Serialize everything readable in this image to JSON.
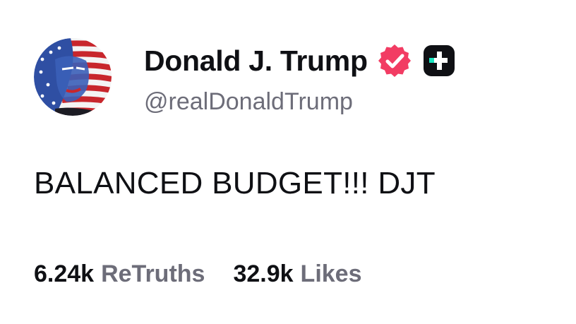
{
  "author": {
    "display_name": "Donald J. Trump",
    "handle": "@realDonaldTrump",
    "verified_icon": "verified-badge-icon",
    "verified_color": "#f23c63",
    "extra_badge_icon": "plus-badge-icon",
    "extra_badge_color": "#0f1014",
    "extra_badge_accent": "#19e5c0"
  },
  "post": {
    "text": "BALANCED BUDGET!!! DJT"
  },
  "stats": {
    "retruths_count": "6.24k",
    "retruths_label": "ReTruths",
    "likes_count": "32.9k",
    "likes_label": "Likes"
  }
}
